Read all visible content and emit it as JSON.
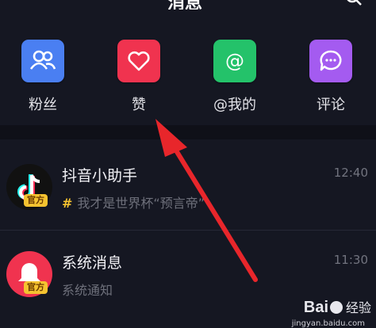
{
  "header": {
    "title": "消息"
  },
  "quick_actions": [
    {
      "label": "粉丝",
      "color": "#4a7ff2",
      "icon": "fans-icon"
    },
    {
      "label": "赞",
      "color": "#f0334f",
      "icon": "heart-icon"
    },
    {
      "label": "@我的",
      "color": "#24c26a",
      "icon": "at-icon"
    },
    {
      "label": "评论",
      "color": "#a45bf0",
      "icon": "comment-icon"
    }
  ],
  "messages": [
    {
      "title": "抖音小助手",
      "time": "12:40",
      "badge": "官方",
      "subtitle": "我才是世界杯“预言帝”",
      "hash": "#"
    },
    {
      "title": "系统消息",
      "time": "11:30",
      "badge": "官方",
      "subtitle": "系统通知"
    }
  ],
  "watermark": {
    "brand": "Bai",
    "brand2": "经验",
    "url": "jingyan.baidu.com"
  },
  "colors": {
    "background": "#151722",
    "arrow": "#e8262b",
    "badge": "#f5c330"
  }
}
